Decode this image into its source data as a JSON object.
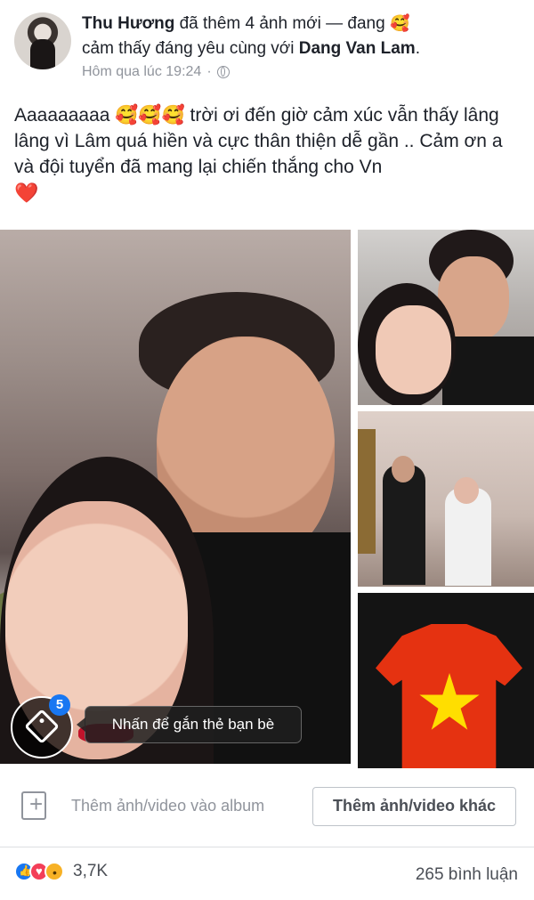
{
  "post": {
    "author": "Thu Hương",
    "action": "đã thêm 4 ảnh mới — đang",
    "feeling_prefix": "cảm thấy đáng yêu cùng với",
    "tagged_person": "Dang Van Lam",
    "timestamp": "Hôm qua lúc 19:24",
    "text": "Aaaaaaaaa 🥰🥰🥰 trời ơi đến giờ cảm xúc vẫn thấy lâng lâng vì Lâm quá hiền và cực thân thiện dễ gần .. Cảm ơn a và đội tuyển đã mang lại chiến thắng cho Vn",
    "heart_emoji": "❤️"
  },
  "media": {
    "tag_badge": "5",
    "tooltip": "Nhấn để gắn thẻ bạn bè"
  },
  "actions": {
    "add_to_album": "Thêm ảnh/video vào album",
    "add_more": "Thêm ảnh/video khác"
  },
  "stats": {
    "reactions_count": "3,7K",
    "comments_count": "265 bình luận"
  },
  "icons": {
    "privacy": "globe-icon",
    "tag": "tag-icon",
    "album": "album-add-icon",
    "reactions": [
      "like-icon",
      "love-icon",
      "wow-icon"
    ]
  },
  "colors": {
    "facebook_blue": "#1877f2",
    "text_primary": "#1d2129",
    "text_secondary": "#90949c",
    "love_red": "#f33e58",
    "wow_yellow": "#f7b125"
  }
}
